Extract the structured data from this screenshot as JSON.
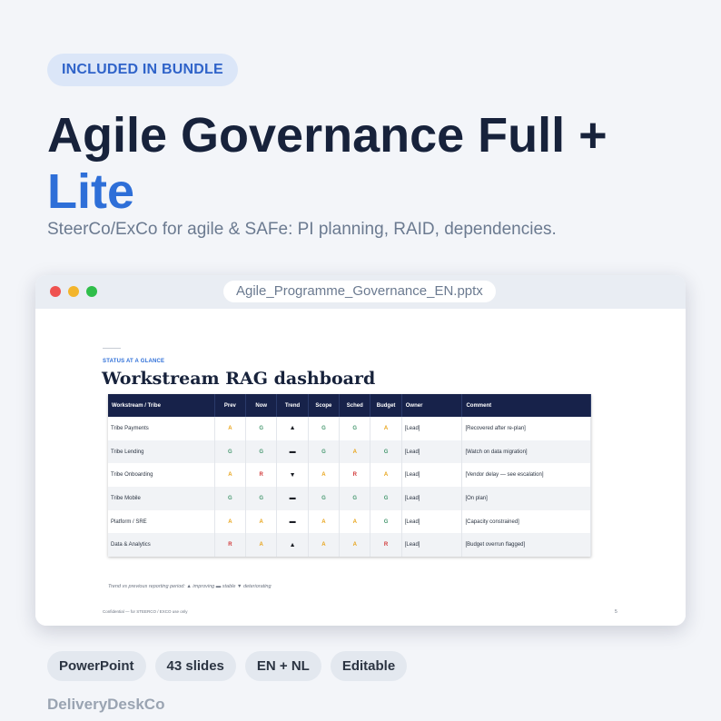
{
  "badge": "INCLUDED IN BUNDLE",
  "title": {
    "line1": "Agile Governance Full +",
    "line2": "Lite"
  },
  "subtitle": "SteerCo/ExCo for agile & SAFe: PI planning, RAID, dependencies.",
  "window": {
    "filename": "Agile_Programme_Governance_EN.pptx"
  },
  "slide": {
    "eyebrow": "STATUS AT A GLANCE",
    "title": "Workstream RAG dashboard",
    "columns": [
      "Workstream / Tribe",
      "Prev",
      "Now",
      "Trend",
      "Scope",
      "Sched",
      "Budget",
      "Owner",
      "Comment"
    ],
    "rows": [
      {
        "ws": "Tribe Payments",
        "prev": "A",
        "now": "G",
        "trend": "▲",
        "scope": "G",
        "sched": "G",
        "budget": "A",
        "owner": "[Lead]",
        "comment": "[Recovered after re-plan]"
      },
      {
        "ws": "Tribe Lending",
        "prev": "G",
        "now": "G",
        "trend": "▬",
        "scope": "G",
        "sched": "A",
        "budget": "G",
        "owner": "[Lead]",
        "comment": "[Watch on data migration]"
      },
      {
        "ws": "Tribe Onboarding",
        "prev": "A",
        "now": "R",
        "trend": "▼",
        "scope": "A",
        "sched": "R",
        "budget": "A",
        "owner": "[Lead]",
        "comment": "[Vendor delay — see escalation]"
      },
      {
        "ws": "Tribe Mobile",
        "prev": "G",
        "now": "G",
        "trend": "▬",
        "scope": "G",
        "sched": "G",
        "budget": "G",
        "owner": "[Lead]",
        "comment": "[On plan]"
      },
      {
        "ws": "Platform / SRE",
        "prev": "A",
        "now": "A",
        "trend": "▬",
        "scope": "A",
        "sched": "A",
        "budget": "G",
        "owner": "[Lead]",
        "comment": "[Capacity constrained]"
      },
      {
        "ws": "Data & Analytics",
        "prev": "R",
        "now": "A",
        "trend": "▲",
        "scope": "A",
        "sched": "A",
        "budget": "R",
        "owner": "[Lead]",
        "comment": "[Budget overrun flagged]"
      }
    ],
    "legend": "Trend vs previous reporting period:  ▲ improving   ▬ stable   ▼ deteriorating",
    "footer_left": "Confidential — for STEERCO / EXCO use only",
    "page_number": "5"
  },
  "chips": [
    "PowerPoint",
    "43 slides",
    "EN + NL",
    "Editable"
  ],
  "brand": "DeliveryDeskCo",
  "colors": {
    "accent": "#2e6fd8",
    "navy": "#17224a",
    "amber": "#e8a317",
    "green": "#4a9a72",
    "red": "#d23a3a"
  }
}
